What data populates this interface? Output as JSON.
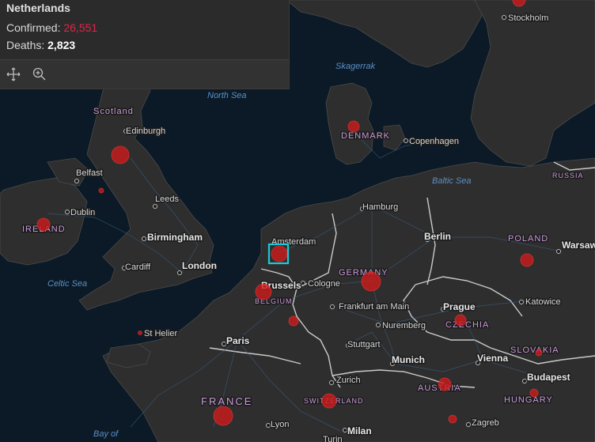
{
  "popup": {
    "title": "Netherlands",
    "confirmed_label": "Confirmed:",
    "confirmed_value": "26,551",
    "deaths_label": "Deaths:",
    "deaths_value": "2,823",
    "tools": [
      {
        "name": "pan-icon"
      },
      {
        "name": "zoom-to-icon"
      }
    ]
  },
  "map": {
    "water_labels": [
      "North Sea",
      "Skagerrak",
      "Baltic Sea",
      "Celtic Sea",
      "Bay of"
    ],
    "country_labels": [
      "Scotland",
      "DENMARK",
      "RUSSIA",
      "IRELAND",
      "POLAND",
      "GERMANY",
      "BELGIUM",
      "CZECHIA",
      "SLOVAKIA",
      "FRANCE",
      "AUSTRIA",
      "SWITZERLAND",
      "HUNGARY"
    ],
    "city_labels": [
      "Stockholm",
      "Edinburgh",
      "Copenhagen",
      "Belfast",
      "Leeds",
      "Dublin",
      "Hamburg",
      "Birmingham",
      "Amsterdam",
      "Berlin",
      "Warsaw",
      "Cardiff",
      "London",
      "Brussels",
      "Cologne",
      "Frankfurt am Main",
      "Prague",
      "Katowice",
      "St Helier",
      "Nuremberg",
      "Paris",
      "Stuttgart",
      "Munich",
      "Vienna",
      "Zurich",
      "Budapest",
      "Lyon",
      "Milan",
      "Zagreb",
      "Turin"
    ],
    "selection_color": "#19c8d6",
    "marker_color": "#d11a1a"
  }
}
